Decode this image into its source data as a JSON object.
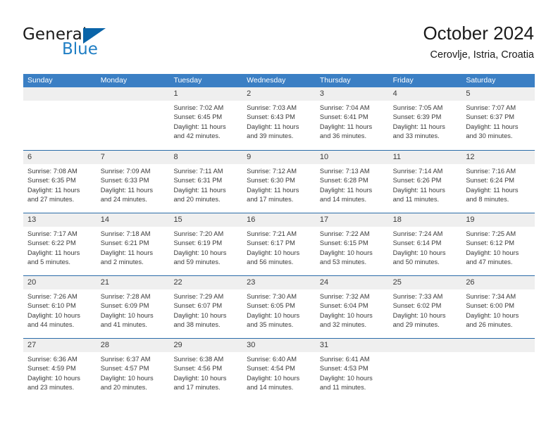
{
  "logo": {
    "word_one": "General",
    "word_two": "Blue",
    "triangle_color": "#0a64a8",
    "blue_text_color": "#1f7ec4"
  },
  "header": {
    "title": "October 2024",
    "subtitle": "Cerovlje, Istria, Croatia"
  },
  "colors": {
    "weekday_header_bg": "#3b7fc4",
    "weekday_header_text": "#ffffff",
    "week_separator": "#2b6ca8",
    "day_number_band": "#efefef",
    "body_text": "#3a3a3a"
  },
  "weekdays": [
    "Sunday",
    "Monday",
    "Tuesday",
    "Wednesday",
    "Thursday",
    "Friday",
    "Saturday"
  ],
  "weeks": [
    [
      {
        "day": "",
        "lines": []
      },
      {
        "day": "",
        "lines": []
      },
      {
        "day": "1",
        "lines": [
          "Sunrise: 7:02 AM",
          "Sunset: 6:45 PM",
          "Daylight: 11 hours",
          "and 42 minutes."
        ]
      },
      {
        "day": "2",
        "lines": [
          "Sunrise: 7:03 AM",
          "Sunset: 6:43 PM",
          "Daylight: 11 hours",
          "and 39 minutes."
        ]
      },
      {
        "day": "3",
        "lines": [
          "Sunrise: 7:04 AM",
          "Sunset: 6:41 PM",
          "Daylight: 11 hours",
          "and 36 minutes."
        ]
      },
      {
        "day": "4",
        "lines": [
          "Sunrise: 7:05 AM",
          "Sunset: 6:39 PM",
          "Daylight: 11 hours",
          "and 33 minutes."
        ]
      },
      {
        "day": "5",
        "lines": [
          "Sunrise: 7:07 AM",
          "Sunset: 6:37 PM",
          "Daylight: 11 hours",
          "and 30 minutes."
        ]
      }
    ],
    [
      {
        "day": "6",
        "lines": [
          "Sunrise: 7:08 AM",
          "Sunset: 6:35 PM",
          "Daylight: 11 hours",
          "and 27 minutes."
        ]
      },
      {
        "day": "7",
        "lines": [
          "Sunrise: 7:09 AM",
          "Sunset: 6:33 PM",
          "Daylight: 11 hours",
          "and 24 minutes."
        ]
      },
      {
        "day": "8",
        "lines": [
          "Sunrise: 7:11 AM",
          "Sunset: 6:31 PM",
          "Daylight: 11 hours",
          "and 20 minutes."
        ]
      },
      {
        "day": "9",
        "lines": [
          "Sunrise: 7:12 AM",
          "Sunset: 6:30 PM",
          "Daylight: 11 hours",
          "and 17 minutes."
        ]
      },
      {
        "day": "10",
        "lines": [
          "Sunrise: 7:13 AM",
          "Sunset: 6:28 PM",
          "Daylight: 11 hours",
          "and 14 minutes."
        ]
      },
      {
        "day": "11",
        "lines": [
          "Sunrise: 7:14 AM",
          "Sunset: 6:26 PM",
          "Daylight: 11 hours",
          "and 11 minutes."
        ]
      },
      {
        "day": "12",
        "lines": [
          "Sunrise: 7:16 AM",
          "Sunset: 6:24 PM",
          "Daylight: 11 hours",
          "and 8 minutes."
        ]
      }
    ],
    [
      {
        "day": "13",
        "lines": [
          "Sunrise: 7:17 AM",
          "Sunset: 6:22 PM",
          "Daylight: 11 hours",
          "and 5 minutes."
        ]
      },
      {
        "day": "14",
        "lines": [
          "Sunrise: 7:18 AM",
          "Sunset: 6:21 PM",
          "Daylight: 11 hours",
          "and 2 minutes."
        ]
      },
      {
        "day": "15",
        "lines": [
          "Sunrise: 7:20 AM",
          "Sunset: 6:19 PM",
          "Daylight: 10 hours",
          "and 59 minutes."
        ]
      },
      {
        "day": "16",
        "lines": [
          "Sunrise: 7:21 AM",
          "Sunset: 6:17 PM",
          "Daylight: 10 hours",
          "and 56 minutes."
        ]
      },
      {
        "day": "17",
        "lines": [
          "Sunrise: 7:22 AM",
          "Sunset: 6:15 PM",
          "Daylight: 10 hours",
          "and 53 minutes."
        ]
      },
      {
        "day": "18",
        "lines": [
          "Sunrise: 7:24 AM",
          "Sunset: 6:14 PM",
          "Daylight: 10 hours",
          "and 50 minutes."
        ]
      },
      {
        "day": "19",
        "lines": [
          "Sunrise: 7:25 AM",
          "Sunset: 6:12 PM",
          "Daylight: 10 hours",
          "and 47 minutes."
        ]
      }
    ],
    [
      {
        "day": "20",
        "lines": [
          "Sunrise: 7:26 AM",
          "Sunset: 6:10 PM",
          "Daylight: 10 hours",
          "and 44 minutes."
        ]
      },
      {
        "day": "21",
        "lines": [
          "Sunrise: 7:28 AM",
          "Sunset: 6:09 PM",
          "Daylight: 10 hours",
          "and 41 minutes."
        ]
      },
      {
        "day": "22",
        "lines": [
          "Sunrise: 7:29 AM",
          "Sunset: 6:07 PM",
          "Daylight: 10 hours",
          "and 38 minutes."
        ]
      },
      {
        "day": "23",
        "lines": [
          "Sunrise: 7:30 AM",
          "Sunset: 6:05 PM",
          "Daylight: 10 hours",
          "and 35 minutes."
        ]
      },
      {
        "day": "24",
        "lines": [
          "Sunrise: 7:32 AM",
          "Sunset: 6:04 PM",
          "Daylight: 10 hours",
          "and 32 minutes."
        ]
      },
      {
        "day": "25",
        "lines": [
          "Sunrise: 7:33 AM",
          "Sunset: 6:02 PM",
          "Daylight: 10 hours",
          "and 29 minutes."
        ]
      },
      {
        "day": "26",
        "lines": [
          "Sunrise: 7:34 AM",
          "Sunset: 6:00 PM",
          "Daylight: 10 hours",
          "and 26 minutes."
        ]
      }
    ],
    [
      {
        "day": "27",
        "lines": [
          "Sunrise: 6:36 AM",
          "Sunset: 4:59 PM",
          "Daylight: 10 hours",
          "and 23 minutes."
        ]
      },
      {
        "day": "28",
        "lines": [
          "Sunrise: 6:37 AM",
          "Sunset: 4:57 PM",
          "Daylight: 10 hours",
          "and 20 minutes."
        ]
      },
      {
        "day": "29",
        "lines": [
          "Sunrise: 6:38 AM",
          "Sunset: 4:56 PM",
          "Daylight: 10 hours",
          "and 17 minutes."
        ]
      },
      {
        "day": "30",
        "lines": [
          "Sunrise: 6:40 AM",
          "Sunset: 4:54 PM",
          "Daylight: 10 hours",
          "and 14 minutes."
        ]
      },
      {
        "day": "31",
        "lines": [
          "Sunrise: 6:41 AM",
          "Sunset: 4:53 PM",
          "Daylight: 10 hours",
          "and 11 minutes."
        ]
      },
      {
        "day": "",
        "lines": []
      },
      {
        "day": "",
        "lines": []
      }
    ]
  ]
}
